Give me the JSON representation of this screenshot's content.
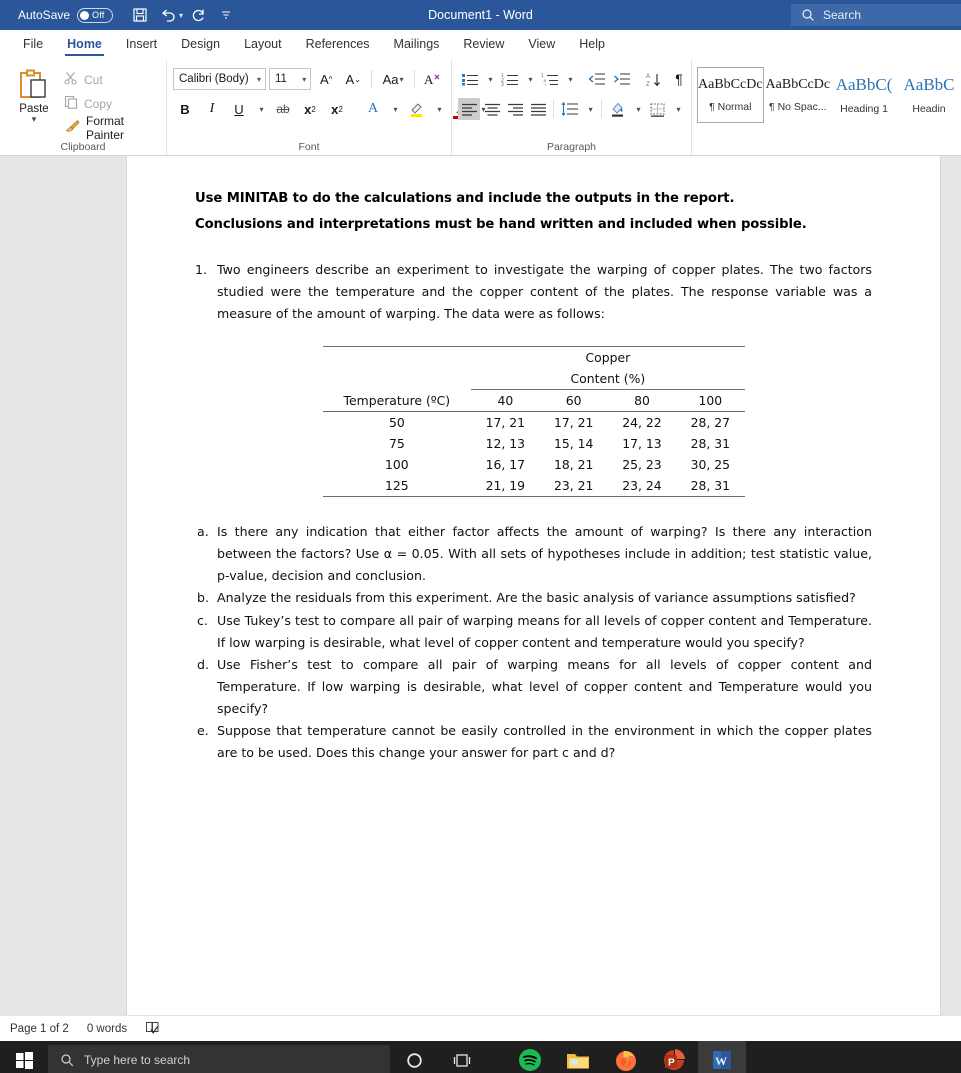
{
  "titlebar": {
    "autosave_label": "AutoSave",
    "autosave_state": "Off",
    "document_title": "Document1  -  Word",
    "search_placeholder": "Search",
    "qat": [
      {
        "name": "save-icon",
        "label": "Save"
      },
      {
        "name": "undo-icon",
        "label": "Undo"
      },
      {
        "name": "redo-icon",
        "label": "Redo"
      },
      {
        "name": "customize-qat-icon",
        "label": "Customize Quick Access Toolbar"
      }
    ]
  },
  "tabs": [
    {
      "label": "File",
      "active": false
    },
    {
      "label": "Home",
      "active": true
    },
    {
      "label": "Insert",
      "active": false
    },
    {
      "label": "Design",
      "active": false
    },
    {
      "label": "Layout",
      "active": false
    },
    {
      "label": "References",
      "active": false
    },
    {
      "label": "Mailings",
      "active": false
    },
    {
      "label": "Review",
      "active": false
    },
    {
      "label": "View",
      "active": false
    },
    {
      "label": "Help",
      "active": false
    }
  ],
  "ribbon": {
    "clipboard": {
      "group_label": "Clipboard",
      "paste_label": "Paste",
      "cut_label": "Cut",
      "copy_label": "Copy",
      "format_painter_label": "Format Painter"
    },
    "font": {
      "group_label": "Font",
      "font_name": "Calibri (Body)",
      "font_size": "11",
      "highlight_color": "#ffe600",
      "font_color": "#c00000",
      "buttons": [
        "grow-font",
        "shrink-font",
        "change-case",
        "clear-formatting",
        "bold",
        "italic",
        "underline",
        "strikethrough",
        "subscript",
        "superscript",
        "text-effects",
        "text-highlight",
        "font-color"
      ]
    },
    "paragraph": {
      "group_label": "Paragraph",
      "buttons": [
        "bullets",
        "numbering",
        "multilevel-list",
        "decrease-indent",
        "increase-indent",
        "sort",
        "show-formatting-marks",
        "align-left",
        "align-center",
        "align-right",
        "justify",
        "line-spacing",
        "shading",
        "borders"
      ],
      "selected_alignment": "align-left"
    },
    "styles": [
      {
        "preview": "AaBbCcDc",
        "name": "¶ Normal",
        "active": true,
        "blue": false
      },
      {
        "preview": "AaBbCcDc",
        "name": "¶ No Spac...",
        "active": false,
        "blue": false
      },
      {
        "preview": "AaBbC(",
        "name": "Heading 1",
        "active": false,
        "blue": true
      },
      {
        "preview": "AaBbC",
        "name": "Headin",
        "active": false,
        "blue": true
      }
    ]
  },
  "document": {
    "heading_line1": "Use MINITAB to do the calculations and include the outputs in the report.",
    "heading_line2": "Conclusions and interpretations must be hand written and included when possible.",
    "numbered": [
      {
        "marker": "1.",
        "text": "Two engineers describe an experiment to investigate the warping of copper plates.  The two factors studied were the temperature and the copper content of the plates.  The response variable was a measure of the amount of warping.  The data were as follows:"
      }
    ],
    "table": {
      "super_header_line1": "Copper",
      "super_header_line2": "Content (%)",
      "row_header_label": "Temperature (ºC)",
      "col_headers": [
        "40",
        "60",
        "80",
        "100"
      ],
      "rows": [
        {
          "temp": "50",
          "cells": [
            "17, 21",
            "17, 21",
            "24, 22",
            "28, 27"
          ]
        },
        {
          "temp": "75",
          "cells": [
            "12, 13",
            "15, 14",
            "17, 13",
            "28, 31"
          ]
        },
        {
          "temp": "100",
          "cells": [
            "16, 17",
            "18, 21",
            "25, 23",
            "30, 25"
          ]
        },
        {
          "temp": "125",
          "cells": [
            "21, 19",
            "23, 21",
            "23, 24",
            "28, 31"
          ]
        }
      ]
    },
    "lettered": [
      {
        "marker": "a.",
        "text": "Is there any indication that either factor affects the amount of warping?  Is there any interaction between the factors?  Use α = 0.05. With all sets of hypotheses include in addition; test statistic value, p-value, decision and conclusion."
      },
      {
        "marker": "b.",
        "text": "Analyze the residuals from this experiment.  Are the basic analysis of variance assumptions satisfied?"
      },
      {
        "marker": "c.",
        "text": "Use Tukey’s test to compare all pair of warping means for all levels of copper content and Temperature.  If low warping is desirable, what level of copper content and temperature would you specify?"
      },
      {
        "marker": "d.",
        "text": "Use Fisher’s test to compare all pair of warping means for all levels of copper content and Temperature.  If low warping is desirable, what level of copper content and Temperature would you specify?"
      },
      {
        "marker": "e.",
        "text": "Suppose that temperature cannot be easily controlled in the environment in which the copper plates are to be used.  Does this change your answer for part c and d?"
      }
    ]
  },
  "statusbar": {
    "page_info": "Page 1 of 2",
    "word_count": "0 words",
    "proofing_icon": "proofing-status-icon"
  },
  "taskbar": {
    "start_icon": "windows-start-icon",
    "search_placeholder": "Type here to search",
    "cortana_icon": "cortana-circle-icon",
    "taskview_icon": "task-view-icon",
    "apps": [
      {
        "name": "spotify",
        "color": "#1db954"
      },
      {
        "name": "file-explorer",
        "color": "#f5bf42"
      },
      {
        "name": "firefox",
        "color": "#ff7139"
      },
      {
        "name": "powerpoint",
        "color": "#c43e1c"
      },
      {
        "name": "word",
        "color": "#2b579a",
        "active": true
      }
    ]
  },
  "theme": {
    "word_blue": "#2b579a",
    "accent_blue": "#2e74b5",
    "taskbar_bg": "#1f1f1f"
  }
}
